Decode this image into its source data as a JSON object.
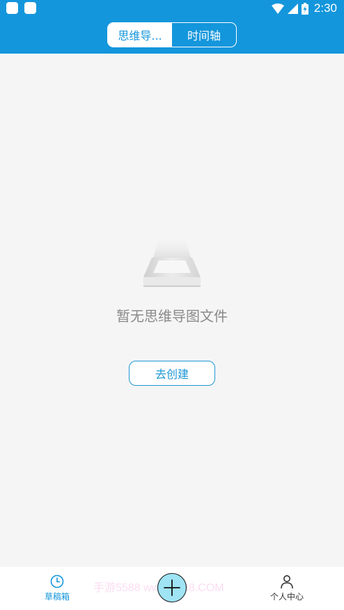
{
  "status_bar": {
    "time": "2:30"
  },
  "header": {
    "tabs": [
      {
        "label": "思维导...",
        "active": true
      },
      {
        "label": "时间轴",
        "active": false
      }
    ]
  },
  "empty_state": {
    "message": "暂无思维导图文件",
    "create_label": "去创建"
  },
  "bottom_nav": {
    "drafts_label": "草稿箱",
    "profile_label": "个人中心",
    "add_icon": "plus-icon"
  },
  "watermark": "手游5588 www.5588.COM",
  "colors": {
    "brand": "#1496dc",
    "background": "#f5f5f5",
    "add_button": "#9fe4f5",
    "empty_text": "#8a8a8a"
  }
}
